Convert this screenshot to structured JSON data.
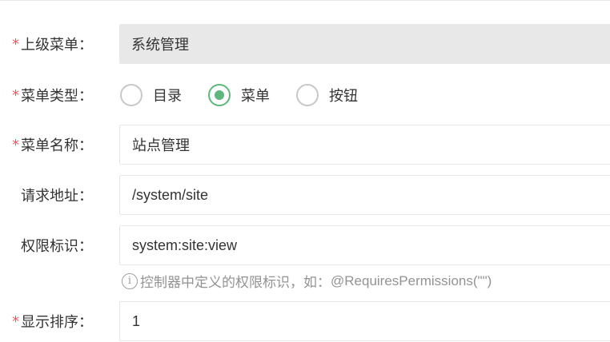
{
  "required_mark": "*",
  "fields": {
    "parent_menu": {
      "label": "上级菜单：",
      "value": "系统管理"
    },
    "menu_type": {
      "label": "菜单类型：",
      "options": [
        {
          "label": "目录",
          "checked": false
        },
        {
          "label": "菜单",
          "checked": true
        },
        {
          "label": "按钮",
          "checked": false
        }
      ]
    },
    "menu_name": {
      "label": "菜单名称：",
      "value": "站点管理"
    },
    "request_url": {
      "label": "请求地址：",
      "value": "/system/site"
    },
    "permission": {
      "label": "权限标识：",
      "value": "system:site:view",
      "help_cn": "控制器中定义的权限标识，如：",
      "help_en": "@RequiresPermissions(\"\")"
    },
    "display_order": {
      "label": "显示排序：",
      "value": "1"
    }
  },
  "colors": {
    "required": "#ed5565",
    "radio_checked": "#5eb87e",
    "disabled_bg": "#e8e8e8",
    "help_text": "#939393"
  },
  "icons": {
    "help": "info-icon"
  }
}
